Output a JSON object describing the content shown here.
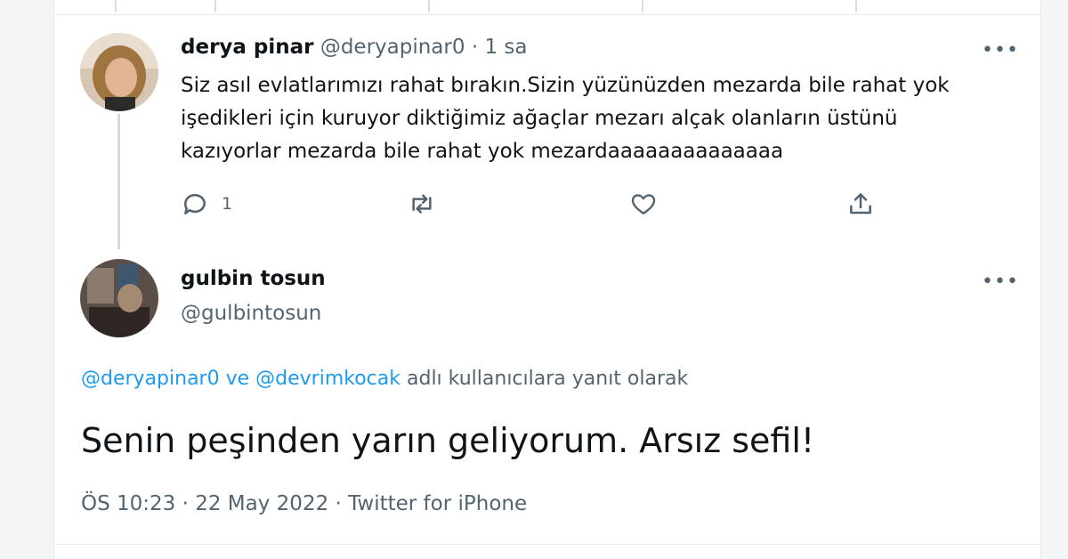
{
  "reply_tweet": {
    "display_name": "derya pinar",
    "handle": "@deryapinar0",
    "separator": "·",
    "time": "1 sa",
    "more_label": "•••",
    "text_lines": [
      "Siz asıl evlatlarımızı rahat bırakın.Sizin yüzünüzden mezarda bile rahat yok",
      "işedikleri için kuruyor diktiğimiz ağaçlar mezarı alçak olanların üstünü",
      "kazıyorlar mezarda bile rahat yok mezardaaaaaaaaaaaaaa"
    ],
    "actions": {
      "reply_icon": "reply-icon",
      "reply_count": "1",
      "retweet_icon": "retweet-icon",
      "like_icon": "heart-icon",
      "share_icon": "share-icon"
    }
  },
  "main_tweet": {
    "display_name": "gulbin tosun",
    "handle": "@gulbintosun",
    "more_label": "•••",
    "replying_to": {
      "user1": "@deryapinar0",
      "connector": "ve",
      "user2": "@devrimkocak",
      "suffix": "adlı kullanıcılara yanıt olarak"
    },
    "text": "Senin peşinden yarın geliyorum. Arsız sefil!",
    "time": "ÖS 10:23",
    "date": "22 May 2022",
    "source": "Twitter for iPhone",
    "separator": "·"
  },
  "colors": {
    "text": "#0f1419",
    "muted": "#536471",
    "link": "#1d9bf0",
    "border": "#e8ebee",
    "thread_line": "#cfd9de"
  }
}
